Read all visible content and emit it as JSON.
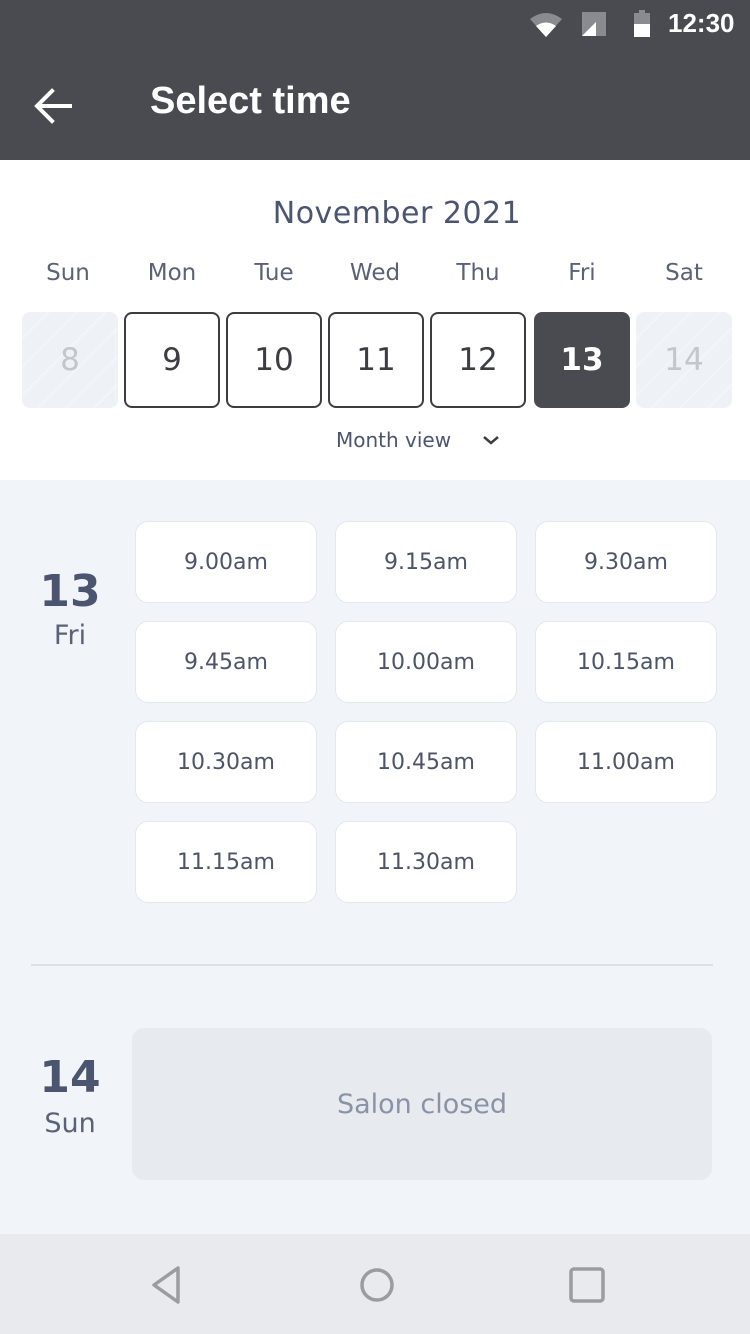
{
  "status_bar": {
    "time": "12:30",
    "icons": [
      "wifi-icon",
      "cellular-signal-icon",
      "battery-icon"
    ]
  },
  "app_bar": {
    "back_icon": "arrow-left-icon",
    "title": "Select time"
  },
  "calendar": {
    "month_label": "November 2021",
    "weekdays": [
      "Sun",
      "Mon",
      "Tue",
      "Wed",
      "Thu",
      "Fri",
      "Sat"
    ],
    "days": [
      {
        "label": "8",
        "state": "disabled"
      },
      {
        "label": "9",
        "state": "available"
      },
      {
        "label": "10",
        "state": "available"
      },
      {
        "label": "11",
        "state": "available"
      },
      {
        "label": "12",
        "state": "available"
      },
      {
        "label": "13",
        "state": "selected"
      },
      {
        "label": "14",
        "state": "disabled"
      }
    ],
    "month_view_label": "Month view",
    "month_view_icon": "chevron-down-icon"
  },
  "schedule": [
    {
      "day_number": "13",
      "day_name": "Fri",
      "slots": [
        "9.00am",
        "9.15am",
        "9.30am",
        "9.45am",
        "10.00am",
        "10.15am",
        "10.30am",
        "10.45am",
        "11.00am",
        "11.15am",
        "11.30am"
      ]
    },
    {
      "day_number": "14",
      "day_name": "Sun",
      "closed_message": "Salon closed"
    }
  ],
  "nav_bar": {
    "buttons": [
      "back-triangle-icon",
      "home-circle-icon",
      "recents-square-icon"
    ]
  },
  "colors": {
    "header": "#4a4b51",
    "accent_text": "#4b5570",
    "background": "#f1f4f8"
  }
}
